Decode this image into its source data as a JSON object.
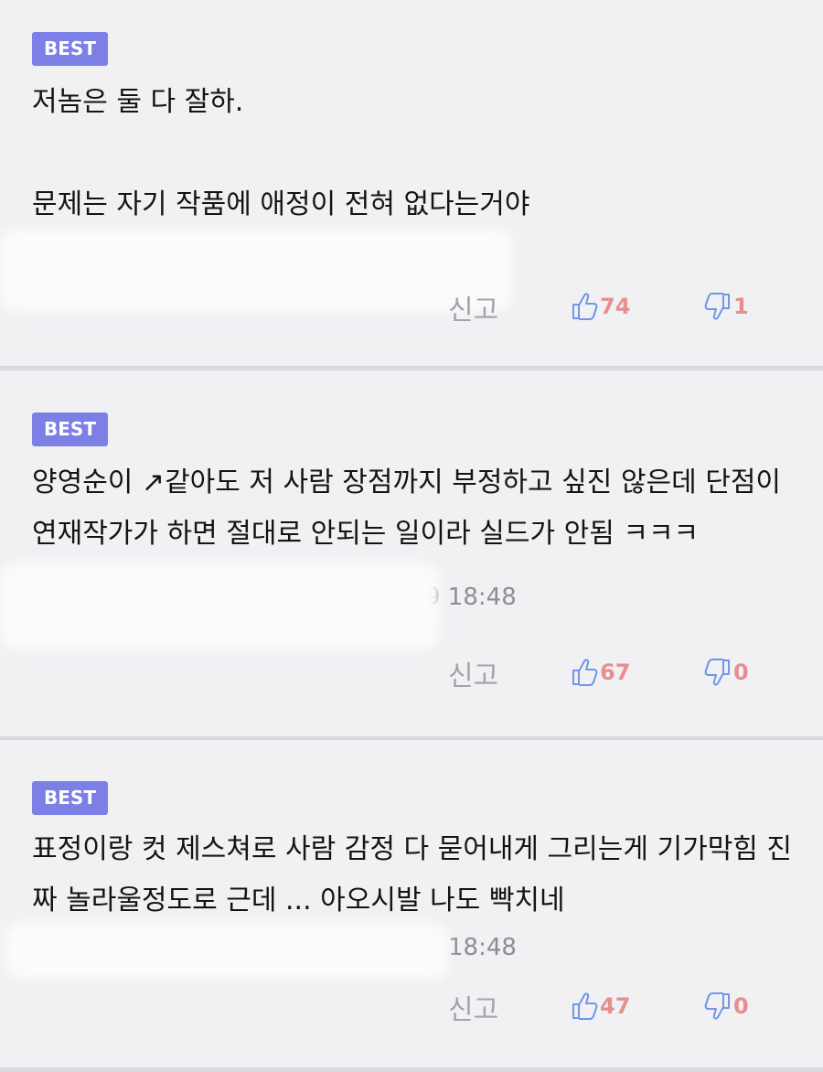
{
  "badge_label": "BEST",
  "report_label": "신고",
  "comments": [
    {
      "text": "저놈은 둘 다 잘하.\n\n문제는 자기 작품에 애정이 전혀 없다는거야",
      "time": "",
      "likes": "74",
      "dislikes": "1"
    },
    {
      "text": "양영순이 ↗같아도 저 사람 장점까지 부정하고 싶진 않은데 단점이 연재작가가 하면 절대로 안되는 일이라 실드가 안됨 ㅋㅋㅋ",
      "time": "9 18:48",
      "likes": "67",
      "dislikes": "0"
    },
    {
      "text": "표정이랑 컷 제스쳐로 사람 감정 다 묻어내게 그리는게 기가막힘 진짜 놀라울정도로 근데 ... 아오시발 나도 빡치네",
      "time": "18:48",
      "likes": "47",
      "dislikes": "0"
    }
  ],
  "colors": {
    "badge": "#7b7fe6",
    "like_icon": "#6f96e8",
    "count": "#e58f8f",
    "report": "#a3a3a8"
  }
}
